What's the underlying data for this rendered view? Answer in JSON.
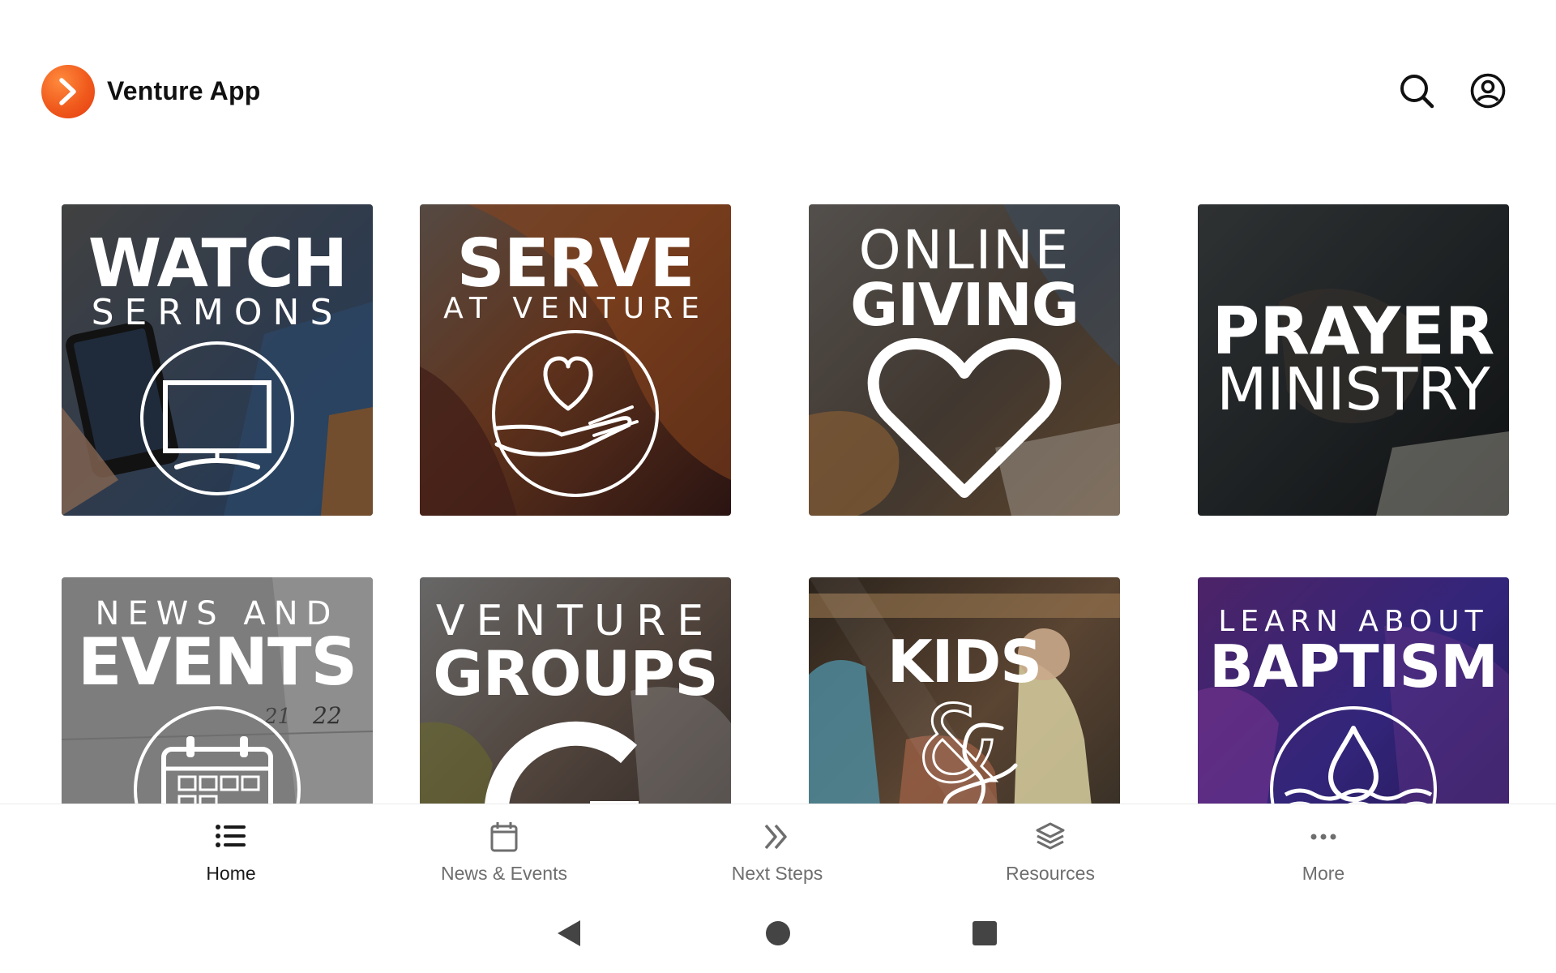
{
  "app": {
    "title": "Venture App",
    "accent": "#f05a1c"
  },
  "header": {
    "search_icon": "search-icon",
    "account_icon": "account-icon"
  },
  "tiles": [
    {
      "name": "watch-sermons",
      "line1": "WATCH",
      "line2": "SERMONS",
      "icon": "tv-icon"
    },
    {
      "name": "serve-at-venture",
      "line1": "SERVE",
      "line2": "AT VENTURE",
      "icon": "heart-in-hand-icon"
    },
    {
      "name": "online-giving",
      "line1": "ONLINE",
      "line2": "GIVING",
      "icon": "heart-icon"
    },
    {
      "name": "prayer-ministry",
      "line1": "PRAYER",
      "line2": "MINISTRY"
    },
    {
      "name": "news-and-events",
      "line1": "NEWS AND",
      "line2": "EVENTS",
      "icon": "calendar-icon"
    },
    {
      "name": "venture-groups",
      "line1": "VENTURE",
      "line2": "GROUPS",
      "icon": "groups-logo-icon"
    },
    {
      "name": "kids",
      "line1": "KIDS",
      "line2": "&"
    },
    {
      "name": "learn-about-baptism",
      "line1": "LEARN ABOUT",
      "line2": "BAPTISM",
      "icon": "water-drop-icon"
    }
  ],
  "bottom_nav": [
    {
      "label": "Home",
      "icon": "list-icon",
      "active": true
    },
    {
      "label": "News & Events",
      "icon": "calendar-icon",
      "active": false
    },
    {
      "label": "Next Steps",
      "icon": "double-chevron-icon",
      "active": false
    },
    {
      "label": "Resources",
      "icon": "layers-icon",
      "active": false
    },
    {
      "label": "More",
      "icon": "more-dots-icon",
      "active": false
    }
  ],
  "system_nav": {
    "back_icon": "back-icon",
    "home_icon": "home-circle-icon",
    "recents_icon": "recents-square-icon"
  }
}
